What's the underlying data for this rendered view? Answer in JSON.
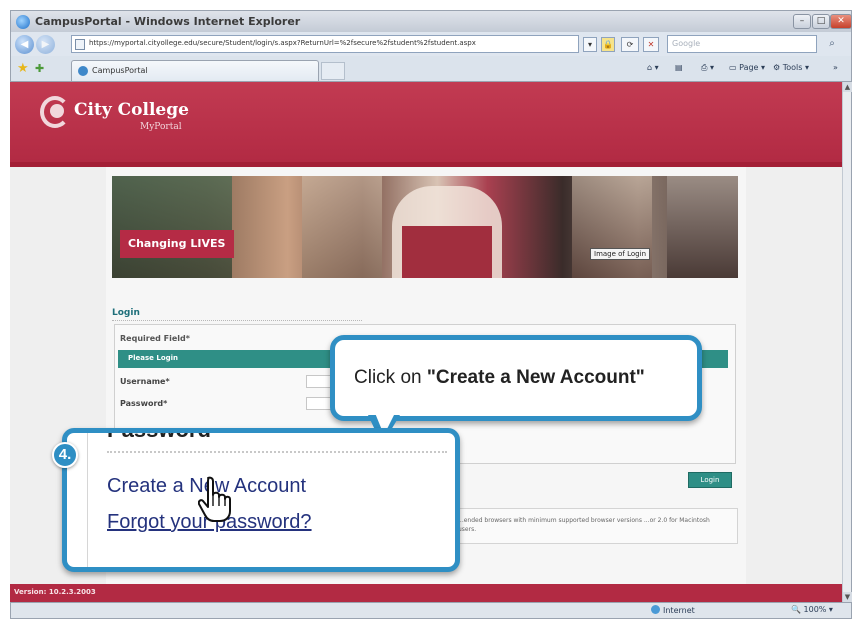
{
  "browser": {
    "window_title": "CampusPortal - Windows Internet Explorer",
    "url": "https://myportal.cityollege.edu/secure/Student/login/s.aspx?ReturnUrl=%2fsecure%2fstudent%2fstudent.aspx",
    "search_placeholder": "Google",
    "tab_label": "CampusPortal",
    "page_menu": "Page",
    "tools_menu": "Tools",
    "status_zone": "Internet",
    "zoom_level": "100%"
  },
  "portal": {
    "logo_name": "City College",
    "logo_sub": "MyPortal",
    "banner_tagline": "Changing LIVES",
    "banner_alt": "Image of Login",
    "login_heading": "Login",
    "required_field": "Required Field*",
    "please_login": "Please Login",
    "username_label": "Username*",
    "password_label": "Password*",
    "login_button": "Login",
    "browser_note": "...ended browsers with minimum supported browser versions ...or 2.0 for Macintosh users.",
    "version": "Version: 10.2.3.2003"
  },
  "callout": {
    "prefix": "Click on ",
    "emphasis": "\"Create a New Account\"",
    "step_number": "4.",
    "zoom_cut_label": "Password",
    "create_account": "Create a New Account",
    "forgot_password": "Forgot your password?"
  }
}
